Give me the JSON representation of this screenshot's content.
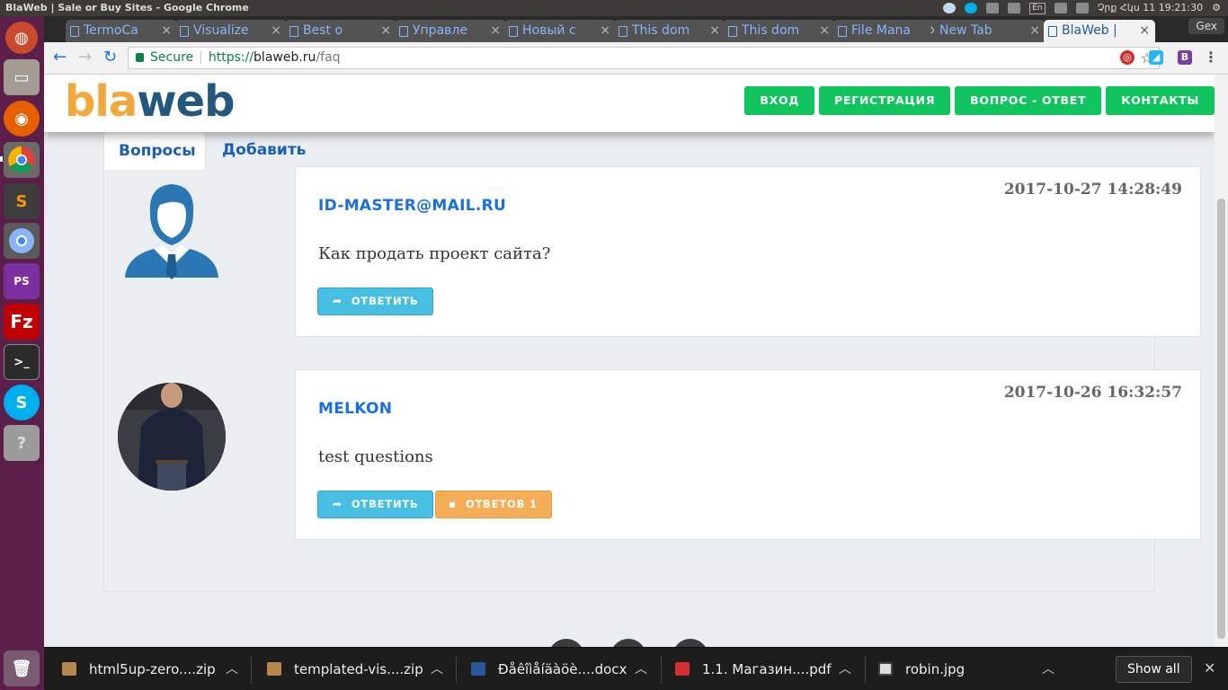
{
  "os": {
    "window_title": "BlaWeb | Sale or Buy Sites - Google Chrome",
    "lang": "En",
    "clock": "Չրք Հկս 11 19:21:30"
  },
  "browser": {
    "tabs": [
      {
        "label": "TermoCa"
      },
      {
        "label": "Visualize"
      },
      {
        "label": "Best o"
      },
      {
        "label": "Управле"
      },
      {
        "label": "Новый с"
      },
      {
        "label": "This dom"
      },
      {
        "label": "This dom"
      },
      {
        "label": "File Mana"
      },
      {
        "label": "New Tab"
      },
      {
        "label": "BlaWeb |"
      }
    ],
    "profile_button": "Gex",
    "omnibox": {
      "secure_label": "Secure",
      "scheme": "https://",
      "host": "blaweb.ru",
      "path": "/faq"
    }
  },
  "site": {
    "logo": {
      "part1": "bla",
      "part2": "web"
    },
    "menu": [
      {
        "label": "ВХОД"
      },
      {
        "label": "РЕГИСТРАЦИЯ"
      },
      {
        "label": "ВОПРОС - ОТВЕТ"
      },
      {
        "label": "КОНТАКТЫ"
      }
    ],
    "tabs": {
      "questions": "Вопросы",
      "add": "Добавить"
    },
    "questions": [
      {
        "author": "ID-MASTER@MAIL.RU",
        "date": "2017-10-27 14:28:49",
        "text": "Как продать проект сайта?",
        "reply_label": "ОТВЕТИТЬ"
      },
      {
        "author": "MELKON",
        "date": "2017-10-26 16:32:57",
        "text": "test questions",
        "reply_label": "ОТВЕТИТЬ",
        "answers_label": "ОТВЕТОВ 1"
      }
    ]
  },
  "downloads": {
    "items": [
      {
        "name": "html5up-zero....zip"
      },
      {
        "name": "templated-vis....zip"
      },
      {
        "name": "Ðåêîìåíäàöè....docx"
      },
      {
        "name": "1.1. Магазин....pdf"
      },
      {
        "name": "robin.jpg"
      }
    ],
    "show_all": "Show all"
  },
  "colors": {
    "menu_green": "#10c55e",
    "logo_orange": "#f2a93b",
    "logo_blue": "#23577e",
    "reply_blue": "#46bfe2",
    "answers_orange": "#f5ad57",
    "link_blue": "#1a6fe0"
  }
}
